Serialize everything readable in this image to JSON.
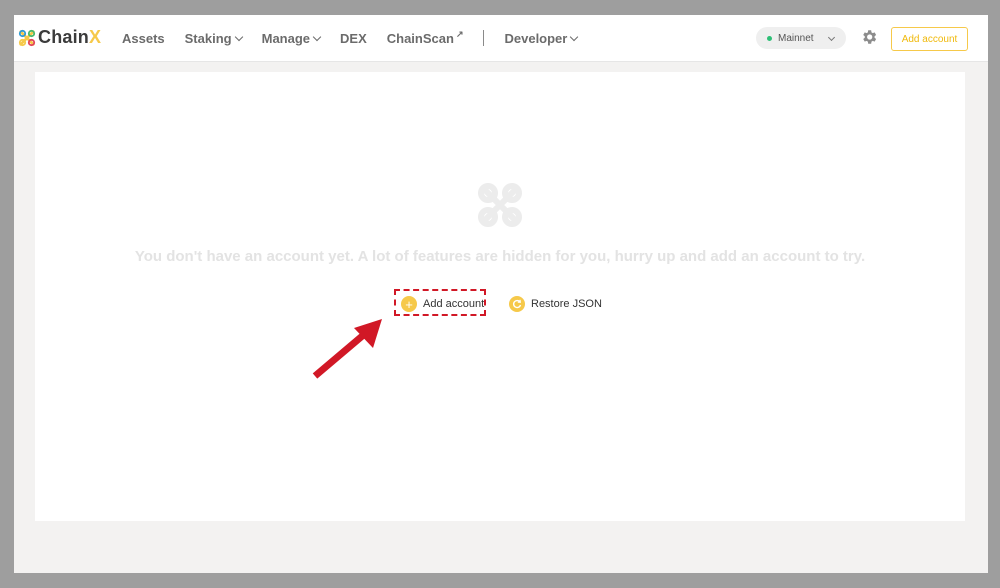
{
  "header": {
    "logo_text_main": "Chain",
    "logo_text_accent": "X",
    "nav": [
      {
        "label": "Assets",
        "dropdown": false
      },
      {
        "label": "Staking",
        "dropdown": true
      },
      {
        "label": "Manage",
        "dropdown": true
      },
      {
        "label": "DEX",
        "dropdown": false
      },
      {
        "label": "ChainScan",
        "external": true
      },
      {
        "label": "Developer",
        "dropdown": true
      }
    ],
    "network": {
      "label": "Mainnet",
      "status_color": "#2dbf76"
    },
    "settings_icon": "gear-icon",
    "add_account_label": "Add account"
  },
  "main": {
    "empty_message": "You don't have an account yet. A lot of features are hidden for you, hurry up and add an account to try.",
    "add_account_label": "Add account",
    "restore_label": "Restore JSON"
  },
  "colors": {
    "accent": "#f6c94a",
    "highlight": "#d11826"
  }
}
